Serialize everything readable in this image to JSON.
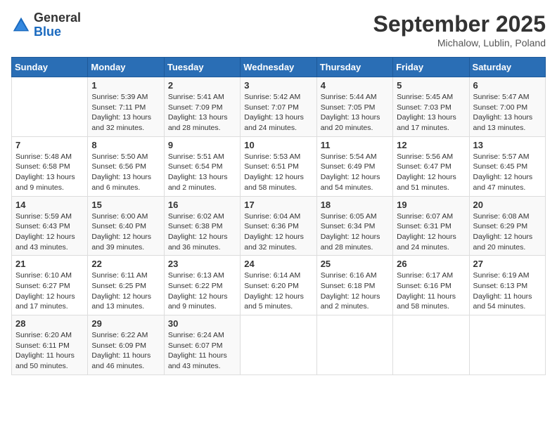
{
  "logo": {
    "general": "General",
    "blue": "Blue"
  },
  "title": "September 2025",
  "location": "Michalow, Lublin, Poland",
  "days_of_week": [
    "Sunday",
    "Monday",
    "Tuesday",
    "Wednesday",
    "Thursday",
    "Friday",
    "Saturday"
  ],
  "weeks": [
    [
      {
        "day": "",
        "sunrise": "",
        "sunset": "",
        "daylight": ""
      },
      {
        "day": "1",
        "sunrise": "Sunrise: 5:39 AM",
        "sunset": "Sunset: 7:11 PM",
        "daylight": "Daylight: 13 hours and 32 minutes."
      },
      {
        "day": "2",
        "sunrise": "Sunrise: 5:41 AM",
        "sunset": "Sunset: 7:09 PM",
        "daylight": "Daylight: 13 hours and 28 minutes."
      },
      {
        "day": "3",
        "sunrise": "Sunrise: 5:42 AM",
        "sunset": "Sunset: 7:07 PM",
        "daylight": "Daylight: 13 hours and 24 minutes."
      },
      {
        "day": "4",
        "sunrise": "Sunrise: 5:44 AM",
        "sunset": "Sunset: 7:05 PM",
        "daylight": "Daylight: 13 hours and 20 minutes."
      },
      {
        "day": "5",
        "sunrise": "Sunrise: 5:45 AM",
        "sunset": "Sunset: 7:03 PM",
        "daylight": "Daylight: 13 hours and 17 minutes."
      },
      {
        "day": "6",
        "sunrise": "Sunrise: 5:47 AM",
        "sunset": "Sunset: 7:00 PM",
        "daylight": "Daylight: 13 hours and 13 minutes."
      }
    ],
    [
      {
        "day": "7",
        "sunrise": "Sunrise: 5:48 AM",
        "sunset": "Sunset: 6:58 PM",
        "daylight": "Daylight: 13 hours and 9 minutes."
      },
      {
        "day": "8",
        "sunrise": "Sunrise: 5:50 AM",
        "sunset": "Sunset: 6:56 PM",
        "daylight": "Daylight: 13 hours and 6 minutes."
      },
      {
        "day": "9",
        "sunrise": "Sunrise: 5:51 AM",
        "sunset": "Sunset: 6:54 PM",
        "daylight": "Daylight: 13 hours and 2 minutes."
      },
      {
        "day": "10",
        "sunrise": "Sunrise: 5:53 AM",
        "sunset": "Sunset: 6:51 PM",
        "daylight": "Daylight: 12 hours and 58 minutes."
      },
      {
        "day": "11",
        "sunrise": "Sunrise: 5:54 AM",
        "sunset": "Sunset: 6:49 PM",
        "daylight": "Daylight: 12 hours and 54 minutes."
      },
      {
        "day": "12",
        "sunrise": "Sunrise: 5:56 AM",
        "sunset": "Sunset: 6:47 PM",
        "daylight": "Daylight: 12 hours and 51 minutes."
      },
      {
        "day": "13",
        "sunrise": "Sunrise: 5:57 AM",
        "sunset": "Sunset: 6:45 PM",
        "daylight": "Daylight: 12 hours and 47 minutes."
      }
    ],
    [
      {
        "day": "14",
        "sunrise": "Sunrise: 5:59 AM",
        "sunset": "Sunset: 6:43 PM",
        "daylight": "Daylight: 12 hours and 43 minutes."
      },
      {
        "day": "15",
        "sunrise": "Sunrise: 6:00 AM",
        "sunset": "Sunset: 6:40 PM",
        "daylight": "Daylight: 12 hours and 39 minutes."
      },
      {
        "day": "16",
        "sunrise": "Sunrise: 6:02 AM",
        "sunset": "Sunset: 6:38 PM",
        "daylight": "Daylight: 12 hours and 36 minutes."
      },
      {
        "day": "17",
        "sunrise": "Sunrise: 6:04 AM",
        "sunset": "Sunset: 6:36 PM",
        "daylight": "Daylight: 12 hours and 32 minutes."
      },
      {
        "day": "18",
        "sunrise": "Sunrise: 6:05 AM",
        "sunset": "Sunset: 6:34 PM",
        "daylight": "Daylight: 12 hours and 28 minutes."
      },
      {
        "day": "19",
        "sunrise": "Sunrise: 6:07 AM",
        "sunset": "Sunset: 6:31 PM",
        "daylight": "Daylight: 12 hours and 24 minutes."
      },
      {
        "day": "20",
        "sunrise": "Sunrise: 6:08 AM",
        "sunset": "Sunset: 6:29 PM",
        "daylight": "Daylight: 12 hours and 20 minutes."
      }
    ],
    [
      {
        "day": "21",
        "sunrise": "Sunrise: 6:10 AM",
        "sunset": "Sunset: 6:27 PM",
        "daylight": "Daylight: 12 hours and 17 minutes."
      },
      {
        "day": "22",
        "sunrise": "Sunrise: 6:11 AM",
        "sunset": "Sunset: 6:25 PM",
        "daylight": "Daylight: 12 hours and 13 minutes."
      },
      {
        "day": "23",
        "sunrise": "Sunrise: 6:13 AM",
        "sunset": "Sunset: 6:22 PM",
        "daylight": "Daylight: 12 hours and 9 minutes."
      },
      {
        "day": "24",
        "sunrise": "Sunrise: 6:14 AM",
        "sunset": "Sunset: 6:20 PM",
        "daylight": "Daylight: 12 hours and 5 minutes."
      },
      {
        "day": "25",
        "sunrise": "Sunrise: 6:16 AM",
        "sunset": "Sunset: 6:18 PM",
        "daylight": "Daylight: 12 hours and 2 minutes."
      },
      {
        "day": "26",
        "sunrise": "Sunrise: 6:17 AM",
        "sunset": "Sunset: 6:16 PM",
        "daylight": "Daylight: 11 hours and 58 minutes."
      },
      {
        "day": "27",
        "sunrise": "Sunrise: 6:19 AM",
        "sunset": "Sunset: 6:13 PM",
        "daylight": "Daylight: 11 hours and 54 minutes."
      }
    ],
    [
      {
        "day": "28",
        "sunrise": "Sunrise: 6:20 AM",
        "sunset": "Sunset: 6:11 PM",
        "daylight": "Daylight: 11 hours and 50 minutes."
      },
      {
        "day": "29",
        "sunrise": "Sunrise: 6:22 AM",
        "sunset": "Sunset: 6:09 PM",
        "daylight": "Daylight: 11 hours and 46 minutes."
      },
      {
        "day": "30",
        "sunrise": "Sunrise: 6:24 AM",
        "sunset": "Sunset: 6:07 PM",
        "daylight": "Daylight: 11 hours and 43 minutes."
      },
      {
        "day": "",
        "sunrise": "",
        "sunset": "",
        "daylight": ""
      },
      {
        "day": "",
        "sunrise": "",
        "sunset": "",
        "daylight": ""
      },
      {
        "day": "",
        "sunrise": "",
        "sunset": "",
        "daylight": ""
      },
      {
        "day": "",
        "sunrise": "",
        "sunset": "",
        "daylight": ""
      }
    ]
  ]
}
